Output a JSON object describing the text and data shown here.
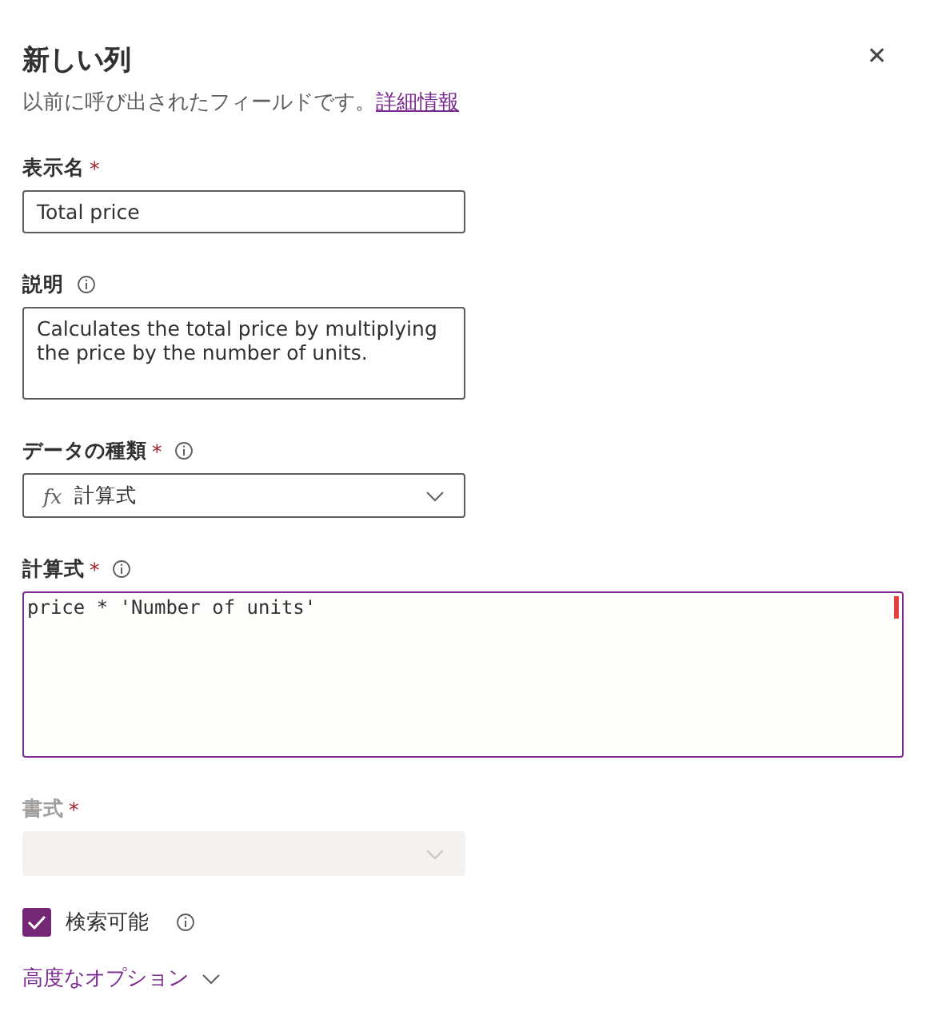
{
  "panel": {
    "title": "新しい列",
    "subtitle": "以前に呼び出されたフィールドです。",
    "link": "詳細情報",
    "close_glyph": "✕"
  },
  "fields": [
    {
      "kind": "text",
      "label": "表示名",
      "required_mark": "*",
      "info": false,
      "disabled": false,
      "value": "Total price"
    },
    {
      "kind": "textarea",
      "label": "説明",
      "info": true,
      "disabled": false,
      "value": "Calculates the total price by multiplying the price by the number of units."
    },
    {
      "kind": "dropdown",
      "label": "データの種類",
      "required_mark": "*",
      "info": true,
      "disabled": false,
      "icon_text": "fx",
      "value": "計算式"
    },
    {
      "kind": "code",
      "label": "計算式",
      "required_mark": "*",
      "info": true,
      "disabled": false,
      "value": "price * 'Number of units'"
    },
    {
      "kind": "dropdown",
      "label": "書式",
      "required_mark": "*",
      "info": false,
      "disabled": true
    }
  ],
  "searchable": {
    "label": "検索可能",
    "checked": true,
    "info": true
  },
  "advanced": {
    "label": "高度なオプション",
    "expanded": false
  }
}
